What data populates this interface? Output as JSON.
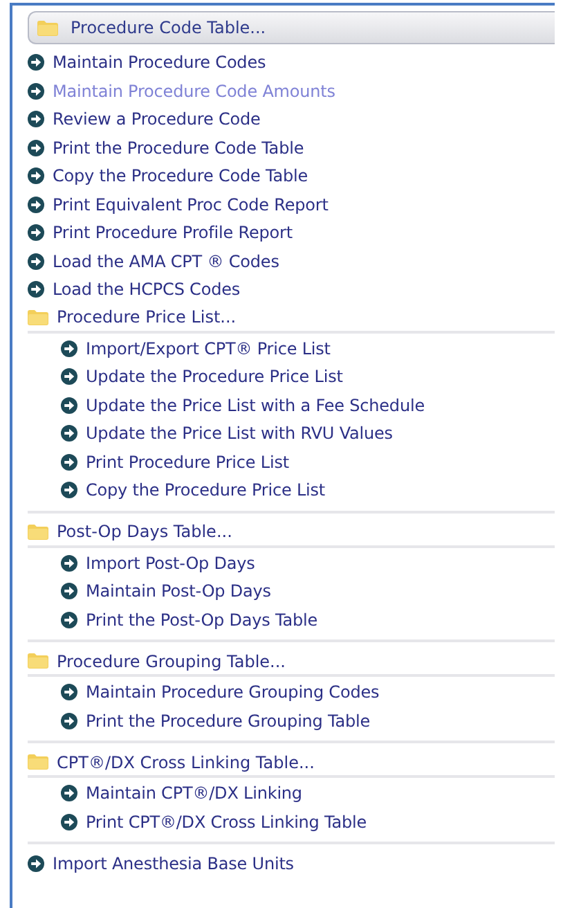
{
  "menu": {
    "title": "Procedure Code Table...",
    "items": [
      {
        "kind": "link",
        "label": "Maintain Procedure Codes",
        "dimmed": false
      },
      {
        "kind": "link",
        "label": "Maintain Procedure Code Amounts",
        "dimmed": true
      },
      {
        "kind": "link",
        "label": "Review a Procedure Code",
        "dimmed": false
      },
      {
        "kind": "link",
        "label": "Print the Procedure Code Table",
        "dimmed": false
      },
      {
        "kind": "link",
        "label": "Copy the Procedure Code Table",
        "dimmed": false
      },
      {
        "kind": "link",
        "label": "Print Equivalent Proc Code Report",
        "dimmed": false
      },
      {
        "kind": "link",
        "label": "Print Procedure Profile Report",
        "dimmed": false
      },
      {
        "kind": "link",
        "label": "Load the AMA CPT ® Codes",
        "dimmed": false
      },
      {
        "kind": "link",
        "label": "Load the HCPCS Codes",
        "dimmed": false
      },
      {
        "kind": "group",
        "label": "Procedure Price List...",
        "items": [
          {
            "kind": "link",
            "label": "Import/Export CPT® Price List",
            "dimmed": false
          },
          {
            "kind": "link",
            "label": "Update the Procedure Price List",
            "dimmed": false
          },
          {
            "kind": "link",
            "label": "Update the Price List with a Fee Schedule",
            "dimmed": false
          },
          {
            "kind": "link",
            "label": "Update the Price List with RVU Values",
            "dimmed": false
          },
          {
            "kind": "link",
            "label": "Print Procedure Price List",
            "dimmed": false
          },
          {
            "kind": "link",
            "label": "Copy the Procedure Price List",
            "dimmed": false
          }
        ]
      },
      {
        "kind": "group",
        "label": "Post-Op Days Table...",
        "items": [
          {
            "kind": "link",
            "label": "Import Post-Op Days",
            "dimmed": false
          },
          {
            "kind": "link",
            "label": "Maintain Post-Op Days",
            "dimmed": false
          },
          {
            "kind": "link",
            "label": "Print the Post-Op Days Table",
            "dimmed": false
          }
        ]
      },
      {
        "kind": "group",
        "label": "Procedure Grouping Table...",
        "items": [
          {
            "kind": "link",
            "label": "Maintain Procedure Grouping Codes",
            "dimmed": false
          },
          {
            "kind": "link",
            "label": "Print the Procedure Grouping Table",
            "dimmed": false
          }
        ]
      },
      {
        "kind": "group",
        "label": "CPT®/DX Cross Linking Table...",
        "items": [
          {
            "kind": "link",
            "label": "Maintain CPT®/DX Linking",
            "dimmed": false
          },
          {
            "kind": "link",
            "label": "Print CPT®/DX Cross Linking Table",
            "dimmed": false
          }
        ]
      },
      {
        "kind": "link",
        "label": "Import Anesthesia Base Units",
        "dimmed": false
      }
    ]
  }
}
